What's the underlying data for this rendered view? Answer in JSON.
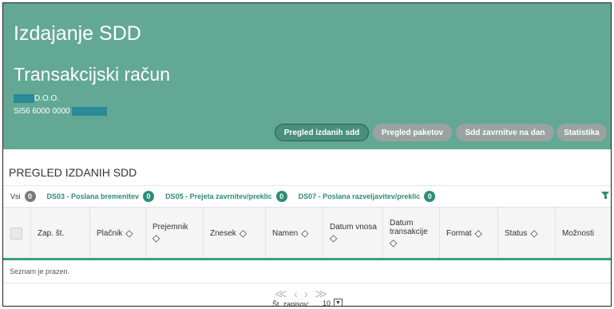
{
  "header": {
    "app_title": "Izdajanje SDD",
    "account_title": "Transakcijski račun",
    "company_suffix": "D.O.O.",
    "iban_prefix": "SI56 6000 0000",
    "buttons": {
      "pregled_izdanih": "Pregled izdanih sdd",
      "pregled_paketov": "Pregled paketov",
      "sdd_zavrnitve": "Sdd zavrnitve na dan",
      "statistika": "Statistika"
    }
  },
  "section": {
    "title": "PREGLED IZDANIH SDD"
  },
  "filters": [
    {
      "label": "Vsi",
      "count": "0"
    },
    {
      "label": "DS03 - Poslana bremenitev",
      "count": "0"
    },
    {
      "label": "DS05 - Prejeta zavrnitev/preklic",
      "count": "0"
    },
    {
      "label": "DS07 - Poslana razveljavitev/preklic",
      "count": "0"
    }
  ],
  "table": {
    "columns": {
      "zap_st": "Zap. št.",
      "placnik": "Plačnik",
      "prejemnik": "Prejemnik",
      "znesek": "Znesek",
      "namen": "Namen",
      "datum_vnosa": "Datum vnosa",
      "datum_transakcije_1": "Datum",
      "datum_transakcije_2": "transakcije",
      "format": "Format",
      "status": "Status",
      "moznosti": "Možnosti"
    },
    "empty_message": "Seznam je prazen."
  },
  "pager": {
    "nav": "≪ ‹   › ≫",
    "records_label": "Št. zapisov:",
    "page_size": "10"
  },
  "colors": {
    "header_bg": "#62a895",
    "accent": "#2e8b78",
    "mask": "#2a8a96",
    "inactive_button": "#9aa3a0"
  }
}
